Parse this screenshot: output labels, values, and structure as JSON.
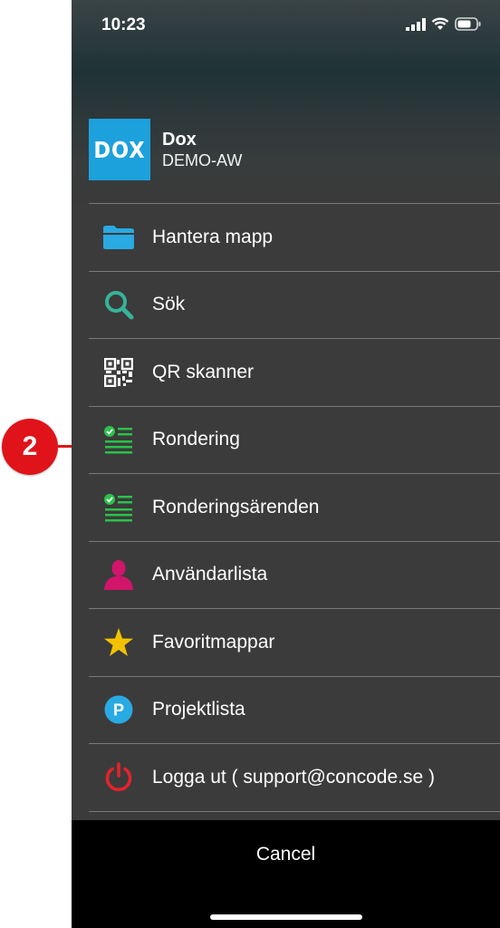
{
  "callout": {
    "number": "2"
  },
  "status_bar": {
    "time": "10:23"
  },
  "header": {
    "logo_text": "DOX",
    "title": "Dox",
    "subtitle": "DEMO-AW"
  },
  "menu": {
    "items": [
      {
        "label": "Hantera mapp",
        "icon": "folder-icon",
        "color": "#29aae2"
      },
      {
        "label": "Sök",
        "icon": "search-icon",
        "color": "#36b39a"
      },
      {
        "label": "QR skanner",
        "icon": "qr-code-icon",
        "color": "#ffffff"
      },
      {
        "label": "Rondering",
        "icon": "checklist-icon",
        "color": "#2bc24a"
      },
      {
        "label": "Ronderingsärenden",
        "icon": "checklist-icon",
        "color": "#2bc24a"
      },
      {
        "label": "Användarlista",
        "icon": "user-icon",
        "color": "#d1156a"
      },
      {
        "label": "Favoritmappar",
        "icon": "star-icon",
        "color": "#f2c200"
      },
      {
        "label": "Projektlista",
        "icon": "project-p-icon",
        "color": "#29aae2"
      },
      {
        "label": "Logga ut ( support@concode.se )",
        "icon": "power-icon",
        "color": "#e4222c"
      }
    ]
  },
  "footer": {
    "cancel_label": "Cancel"
  }
}
